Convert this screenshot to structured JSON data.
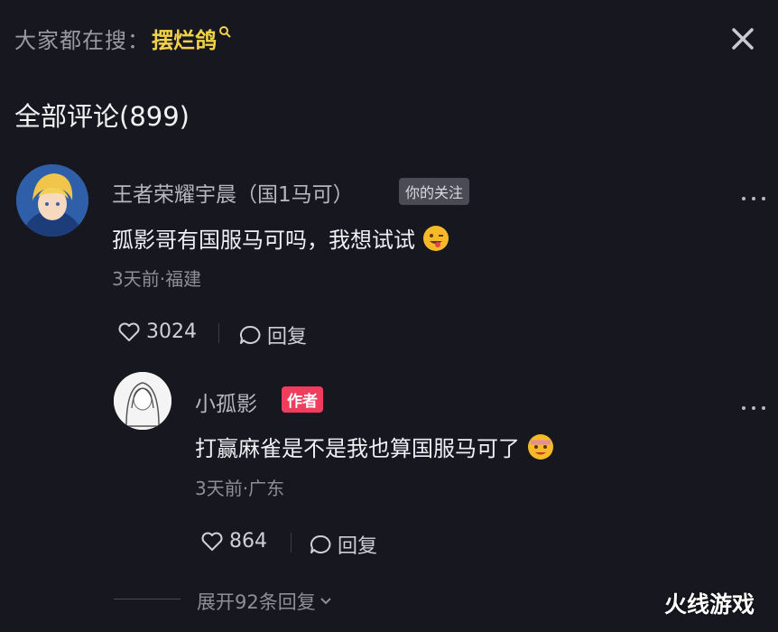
{
  "search": {
    "prefix": "大家都在搜：",
    "term": "摆烂鸽"
  },
  "comments_header": {
    "title": "全部评论(899)"
  },
  "comment": {
    "username": "王者荣耀宇晨（国1马可）",
    "badge": "你的关注",
    "text": "孤影哥有国服马可吗，我想试试",
    "meta": "3天前·福建",
    "likes": "3024",
    "reply_label": "回复"
  },
  "reply": {
    "username": "小孤影",
    "badge": "作者",
    "text": "打赢麻雀是不是我也算国服马可了",
    "meta": "3天前·广东",
    "likes": "864",
    "reply_label": "回复"
  },
  "expand": {
    "label": "展开92条回复"
  },
  "watermark": {
    "text": "火线游戏"
  },
  "colors": {
    "background": "#16171f",
    "search_term": "#f3d24a",
    "author_badge": "#f03d5e"
  }
}
